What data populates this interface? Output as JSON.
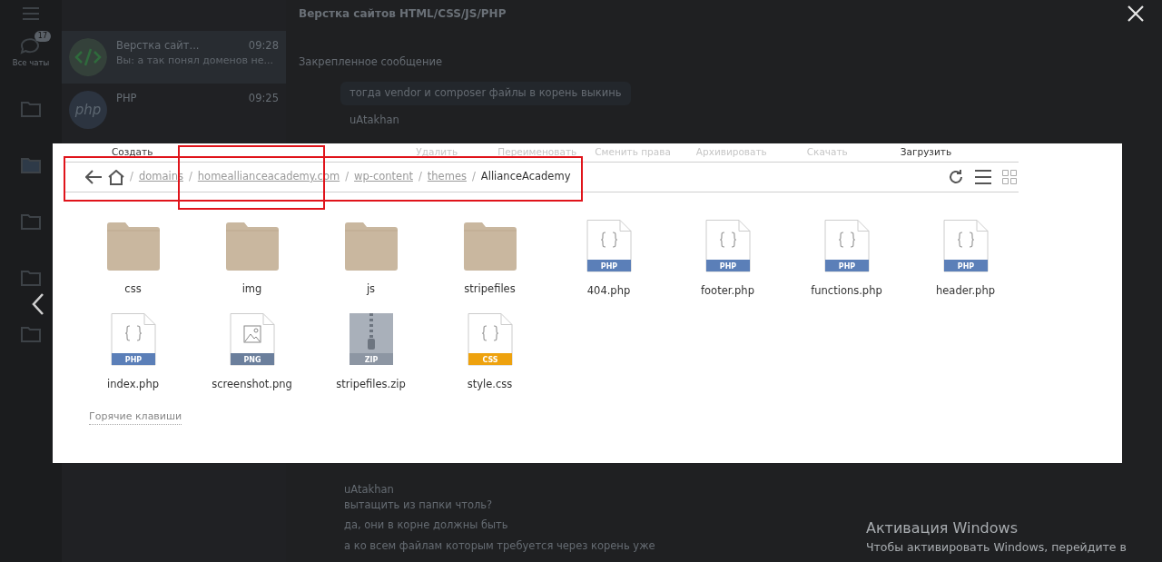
{
  "rail": {
    "label": "Все чаты",
    "badge": "17"
  },
  "chats": [
    {
      "title": "Верстка сайт...",
      "time": "09:28",
      "preview": "Вы: а так понял доменов не...",
      "selected": true
    },
    {
      "title": "PHP",
      "time": "09:25",
      "avatar_text": "php",
      "selected": false
    }
  ],
  "chat": {
    "title": "Верстка сайтов HTML/CSS/JS/PHP",
    "pinned": "Закрепленное сообщение",
    "top_message": "тогда vendor и composer файлы в корень выкинь",
    "top_author": "uAtakhan",
    "reply_author": "uAtakhan",
    "reply_text": "вытащить из папки чтоль?",
    "bottom_messages": [
      "да, они в корне должны быть",
      "а ко всем файлам которым требуется через корень уже"
    ]
  },
  "file_manager": {
    "toolbar": [
      {
        "label": "Создать",
        "disabled": false
      },
      {
        "label": "Удалить",
        "disabled": true
      },
      {
        "label": "Переименовать",
        "disabled": true
      },
      {
        "label": "Сменить права",
        "disabled": true
      },
      {
        "label": "Архивировать",
        "disabled": true
      },
      {
        "label": "Скачать",
        "disabled": true
      },
      {
        "label": "Загрузить",
        "disabled": false
      }
    ],
    "breadcrumb": [
      {
        "sep": "/",
        "label": "domains",
        "link": true
      },
      {
        "sep": "/",
        "label": "homeallianceacademy.com",
        "link": true
      },
      {
        "sep": "/",
        "label": "wp-content",
        "link": true
      },
      {
        "sep": "/",
        "label": "themes",
        "link": true
      },
      {
        "sep": "/",
        "label": "AllianceAcademy",
        "link": false
      }
    ],
    "files": [
      {
        "name": "css",
        "kind": "folder"
      },
      {
        "name": "img",
        "kind": "folder"
      },
      {
        "name": "js",
        "kind": "folder"
      },
      {
        "name": "stripefiles",
        "kind": "folder"
      },
      {
        "name": "404.php",
        "kind": "code",
        "ext": "PHP",
        "color": "#5b7fb8"
      },
      {
        "name": "footer.php",
        "kind": "code",
        "ext": "PHP",
        "color": "#5b7fb8"
      },
      {
        "name": "functions.php",
        "kind": "code",
        "ext": "PHP",
        "color": "#5b7fb8"
      },
      {
        "name": "header.php",
        "kind": "code",
        "ext": "PHP",
        "color": "#5b7fb8"
      },
      {
        "name": "index.php",
        "kind": "code",
        "ext": "PHP",
        "color": "#5b7fb8"
      },
      {
        "name": "screenshot.png",
        "kind": "image",
        "ext": "PNG",
        "color": "#6b7f9c"
      },
      {
        "name": "stripefiles.zip",
        "kind": "zip",
        "ext": "ZIP",
        "color": "#8d96a3"
      },
      {
        "name": "style.css",
        "kind": "code",
        "ext": "CSS",
        "color": "#eea20e"
      }
    ],
    "hotkeys": "Горячие клавиши"
  },
  "windows_notice": {
    "title": "Активация Windows",
    "text": "Чтобы активировать Windows, перейдите в"
  }
}
